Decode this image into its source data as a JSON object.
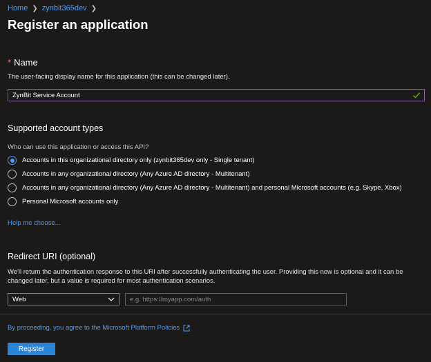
{
  "breadcrumb": {
    "items": [
      "Home",
      "zynbit365dev"
    ]
  },
  "page_title": "Register an application",
  "name_section": {
    "required_mark": "*",
    "label": "Name",
    "description": "The user-facing display name for this application (this can be changed later).",
    "value": "ZynBit Service Account"
  },
  "account_types": {
    "title": "Supported account types",
    "question": "Who can use this application or access this API?",
    "options": [
      {
        "label": "Accounts in this organizational directory only (zynbit365dev only - Single tenant)",
        "selected": true
      },
      {
        "label": "Accounts in any organizational directory (Any Azure AD directory - Multitenant)",
        "selected": false
      },
      {
        "label": "Accounts in any organizational directory (Any Azure AD directory - Multitenant) and personal Microsoft accounts (e.g. Skype, Xbox)",
        "selected": false
      },
      {
        "label": "Personal Microsoft accounts only",
        "selected": false
      }
    ],
    "help_link": "Help me choose..."
  },
  "redirect_uri": {
    "title": "Redirect URI (optional)",
    "description": "We'll return the authentication response to this URI after successfully authenticating the user. Providing this now is optional and it can be changed later, but a value is required for most authentication scenarios.",
    "platform_selected": "Web",
    "uri_placeholder": "e.g. https://myapp.com/auth"
  },
  "footer": {
    "policy_text": "By proceeding, you agree to the Microsoft Platform Policies",
    "register_label": "Register"
  },
  "colors": {
    "background": "#1b1a19",
    "link": "#4f9df4",
    "primary_button": "#2c84d8",
    "focus_border": "#8a61a6",
    "valid_check": "#6bb700",
    "required": "#f1707b"
  }
}
